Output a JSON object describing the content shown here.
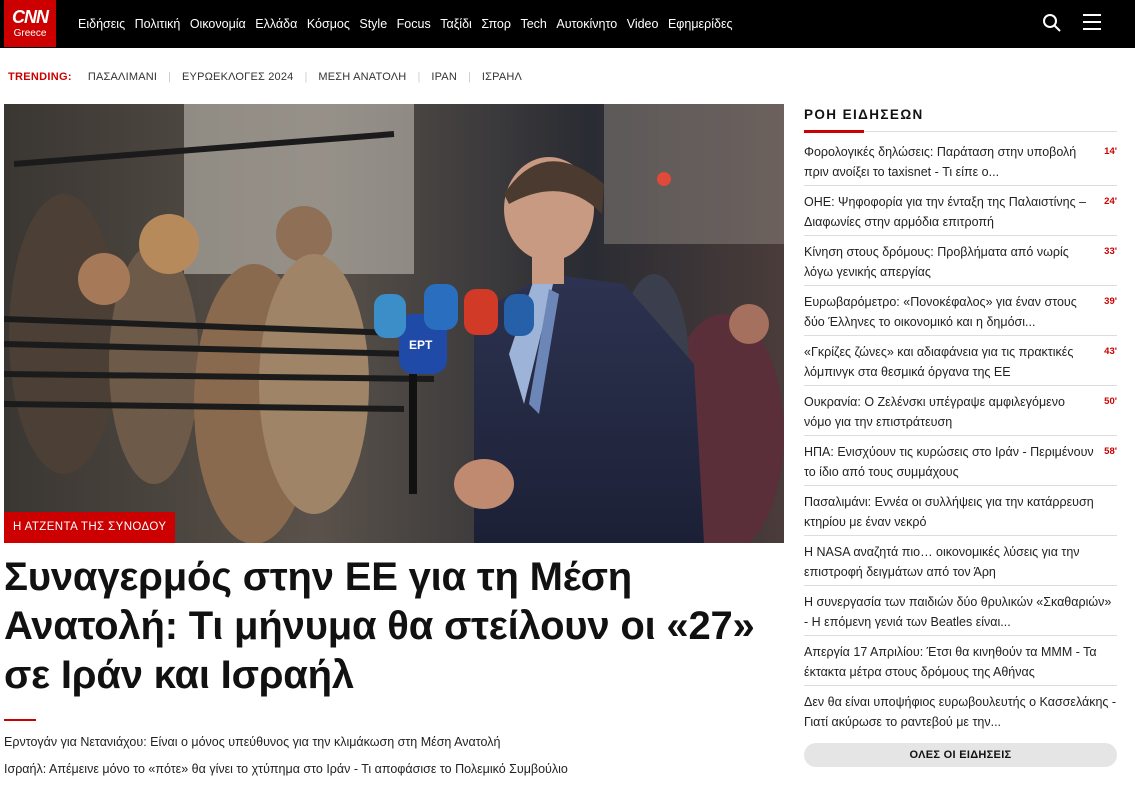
{
  "logo": {
    "brand": "CNN",
    "edition": "Greece"
  },
  "nav": {
    "items": [
      "Ειδήσεις",
      "Πολιτική",
      "Οικονομία",
      "Ελλάδα",
      "Κόσμος",
      "Style",
      "Focus",
      "Ταξίδι",
      "Σπορ",
      "Tech",
      "Αυτοκίνητο",
      "Video",
      "Εφημερίδες"
    ]
  },
  "header_icons": {
    "search": "search-icon",
    "menu": "hamburger-menu-icon"
  },
  "trending": {
    "label": "TRENDING:",
    "items": [
      "ΠΑΣΑΛΙΜΑΝΙ",
      "ΕΥΡΩΕΚΛΟΓΕΣ 2024",
      "ΜΕΣΗ ΑΝΑΤΟΛΗ",
      "ΙΡΑΝ",
      "ΙΣΡΑΗΛ"
    ]
  },
  "hero": {
    "tag": "Η ΑΤΖΕΝΤΑ ΤΗΣ ΣΥΝΟΔΟΥ",
    "headline": "Συναγερμός στην ΕΕ για τη Μέση Ανατολή: Τι μήνυμα θα στείλουν οι «27» σε Ιράν και Ισραήλ",
    "mic_label": "ΕΡΤ",
    "related": [
      "Ερντογάν για Νετανιάχου: Είναι ο μόνος υπεύθυνος για την κλιμάκωση στη Μέση Ανατολή",
      "Ισραήλ: Απέμεινε μόνο το «πότε» θα γίνει το χτύπημα στο Ιράν - Τι αποφάσισε το Πολεμικό Συμβούλιο"
    ]
  },
  "sidebar": {
    "title": "ΡΟΗ ΕΙΔΗΣΕΩΝ",
    "news": [
      {
        "text": "Φορολογικές δηλώσεις: Παράταση στην υποβολή πριν ανοίξει το taxisnet - Τι είπε ο...",
        "time": "14'"
      },
      {
        "text": "ΟΗΕ: Ψηφοφορία για την ένταξη της Παλαιστίνης – Διαφωνίες στην αρμόδια επιτροπή",
        "time": "24'"
      },
      {
        "text": "Κίνηση στους δρόμους: Προβλήματα από νωρίς λόγω γενικής απεργίας",
        "time": "33'"
      },
      {
        "text": "Ευρωβαρόμετρο: «Πονοκέφαλος» για έναν στους δύο Έλληνες το οικονομικό και η δημόσι...",
        "time": "39'"
      },
      {
        "text": "«Γκρίζες ζώνες» και αδιαφάνεια για τις πρακτικές λόμπινγκ στα θεσμικά όργανα της ΕΕ",
        "time": "43'"
      },
      {
        "text": "Ουκρανία: Ο Ζελένσκι υπέγραψε αμφιλεγόμενο νόμο για την επιστράτευση",
        "time": "50'"
      },
      {
        "text": "ΗΠΑ: Ενισχύουν τις κυρώσεις στο Ιράν - Περιμένουν το ίδιο από τους συμμάχους",
        "time": "58'"
      },
      {
        "text": "Πασαλιμάνι: Εννέα οι συλλήψεις για την κατάρρευση κτηρίου με έναν νεκρό",
        "time": ""
      },
      {
        "text": "Η NASA αναζητά πιο… οικονομικές λύσεις για την επιστροφή δειγμάτων από τον Άρη",
        "time": ""
      },
      {
        "text": "Η συνεργασία των παιδιών δύο θρυλικών «Σκαθαριών» - Η επόμενη γενιά των Beatles είναι...",
        "time": ""
      },
      {
        "text": "Απεργία 17 Απριλίου: Έτσι θα κινηθούν τα ΜΜΜ - Τα έκτακτα μέτρα στους δρόμους της Αθήνας",
        "time": ""
      },
      {
        "text": "Δεν θα είναι υποψήφιος ευρωβουλευτής ο Κασσελάκης - Γιατί ακύρωσε το ραντεβού με την...",
        "time": ""
      }
    ],
    "all_news_button": "ΟΛΕΣ ΟΙ ΕΙΔΗΣΕΙΣ"
  },
  "colors": {
    "brand_red": "#cc0000",
    "topbar": "#000000"
  }
}
